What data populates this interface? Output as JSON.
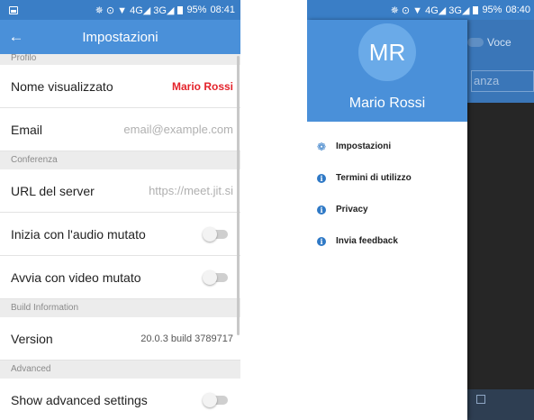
{
  "left": {
    "status": {
      "icons": "✵ ⊙ ▼ 4G◢ 3G◢",
      "battery": "95%",
      "time": "08:41"
    },
    "appbar": {
      "back_icon": "←",
      "title": "Impostazioni"
    },
    "sections": {
      "profile": "Profilo",
      "conference": "Conferenza",
      "build": "Build Information",
      "advanced": "Advanced"
    },
    "rows": {
      "display_name": {
        "label": "Nome visualizzato",
        "value": "Mario Rossi"
      },
      "email": {
        "label": "Email",
        "placeholder": "email@example.com"
      },
      "server_url": {
        "label": "URL del server",
        "placeholder": "https://meet.jit.si"
      },
      "audio_muted": {
        "label": "Inizia con l'audio mutato"
      },
      "video_muted": {
        "label": "Avvia con video mutato"
      },
      "version": {
        "label": "Version",
        "value": "20.0.3 build 3789717"
      },
      "advanced_settings": {
        "label": "Show advanced settings"
      }
    }
  },
  "right": {
    "status": {
      "icons": "✵ ⊙ ▼ 4G◢ 3G◢",
      "battery": "95%",
      "time": "08:40"
    },
    "background": {
      "voice_label": "Voce",
      "input_text": "anza"
    },
    "drawer": {
      "initials": "MR",
      "name": "Mario Rossi",
      "items": [
        {
          "icon": "gear-icon",
          "label": "Impostazioni"
        },
        {
          "icon": "info-icon",
          "label": "Termini di utilizzo"
        },
        {
          "icon": "info-icon",
          "label": "Privacy"
        },
        {
          "icon": "info-icon",
          "label": "Invia feedback"
        }
      ]
    }
  },
  "colors": {
    "status_bar": "#3a7ec6",
    "app_bar": "#4a90d9",
    "accent_red": "#e4232b",
    "icon_blue": "#2f79c6"
  }
}
